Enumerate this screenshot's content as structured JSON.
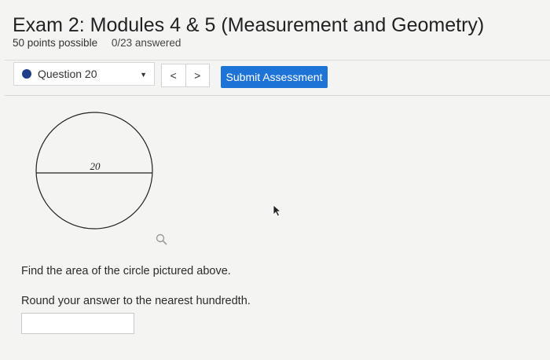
{
  "header": {
    "title": "Exam 2: Modules 4 & 5 (Measurement and Geometry)",
    "points": "50 points possible",
    "answered": "0/23 answered"
  },
  "toolbar": {
    "question_select": "Question 20",
    "prev_label": "<",
    "next_label": ">",
    "submit_label": "Submit Assessment"
  },
  "question": {
    "figure": {
      "diameter_label": "20"
    },
    "prompt": "Find the area of the circle pictured above.",
    "instruction": "Round your answer to the nearest hundredth.",
    "answer_value": ""
  },
  "icons": {
    "status_dot": "filled-circle-icon",
    "dropdown": "caret-down-icon",
    "magnifier": "zoom-icon",
    "cursor": "mouse-pointer-icon"
  },
  "colors": {
    "accent": "#1e73d6",
    "status_dot": "#1f3f8a"
  }
}
